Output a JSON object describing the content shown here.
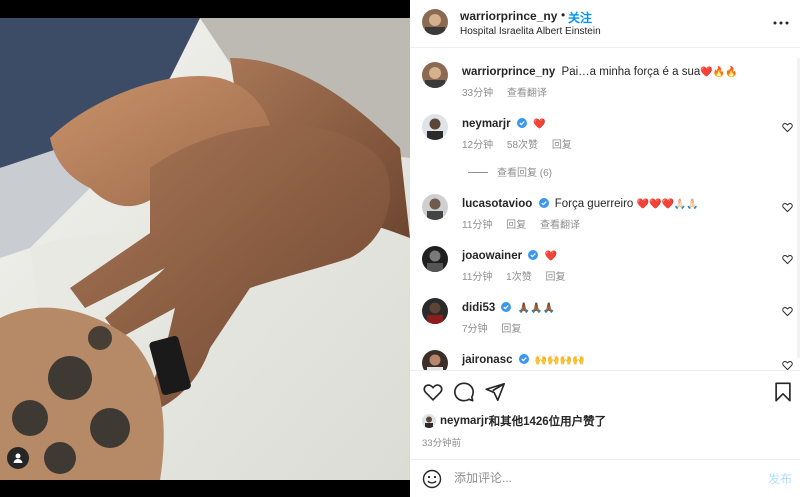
{
  "post": {
    "username": "warriorprince_ny",
    "follow_label": "关注",
    "separator": "•",
    "location": "Hospital Israelita Albert Einstein"
  },
  "caption": {
    "username": "warriorprince_ny",
    "text": "Pai…a minha força é a sua",
    "emoji": "❤️🔥🔥",
    "time": "33分钟",
    "translate_label": "查看翻译"
  },
  "comments": [
    {
      "username": "neymarjr",
      "verified": true,
      "text": "",
      "emoji": "❤️",
      "time": "12分钟",
      "likes": "58次赞",
      "reply": "回复",
      "extra": "",
      "view_replies": "查看回复 (6)"
    },
    {
      "username": "lucasotavioo",
      "verified": true,
      "text": "Força guerreiro",
      "emoji": "❤️❤️❤️🙏🏻🙏🏻",
      "time": "11分钟",
      "likes": "",
      "reply": "回复",
      "extra": "查看翻译"
    },
    {
      "username": "joaowainer",
      "verified": true,
      "text": "",
      "emoji": "❤️",
      "time": "11分钟",
      "likes": "1次赞",
      "reply": "回复",
      "extra": ""
    },
    {
      "username": "didi53",
      "verified": true,
      "text": "",
      "emoji": "🙏🏾🙏🏾🙏🏾",
      "time": "7分钟",
      "likes": "",
      "reply": "回复",
      "extra": ""
    },
    {
      "username": "jaironasc",
      "verified": true,
      "text": "",
      "emoji": "🙌🙌🙌🙌",
      "time": "",
      "likes": "",
      "reply": "",
      "extra": ""
    }
  ],
  "likes_summary": {
    "user": "neymarjr",
    "rest": "和其他1426位用户赞了"
  },
  "time_ago": "33分钟前",
  "add_comment": {
    "placeholder": "添加评论...",
    "post_label": "发布"
  },
  "colors": {
    "accent": "#0095f6",
    "verified": "#3897f0",
    "muted": "#8e8e8e",
    "post_disabled": "#b2dffc"
  },
  "icons": [
    "more-icon",
    "heart-icon",
    "comment-icon",
    "share-icon",
    "bookmark-icon",
    "emoji-icon",
    "user-tag-icon",
    "verified-icon"
  ]
}
